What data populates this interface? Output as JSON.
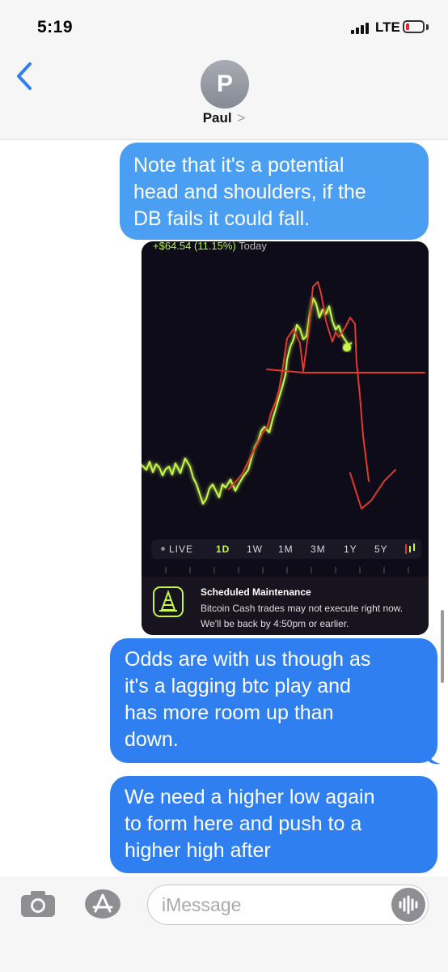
{
  "status_bar": {
    "time": "5:19",
    "network": "LTE",
    "icons": [
      "signal-icon",
      "battery-low-icon"
    ],
    "battery_color": "#e2292c"
  },
  "header": {
    "avatar_initial": "P",
    "contact_name": "Paul",
    "chevron": ">",
    "icons": [
      "back-chevron-icon"
    ]
  },
  "messages": [
    {
      "text": "Note that it's a potential head and shoulders, if the DB fails it could fall.",
      "lines": [
        "Note that it's a potential",
        "head and shoulders, if the",
        "DB fails it could fall."
      ],
      "color": "#4b9ff2"
    },
    {
      "text": "Odds are with us though as it's a lagging btc play and has more room up than down.",
      "lines": [
        "Odds are with us though as",
        "it's a lagging btc play and",
        "has more room up than",
        "down."
      ],
      "color": "#2f7ff0"
    },
    {
      "text": "We need a higher low again to form here and push to a higher high after",
      "lines": [
        "We need a higher low again",
        "to form here and push to a",
        "higher high after"
      ],
      "color": "#2f7ff0"
    }
  ],
  "attachment": {
    "gain_value": "+$64.54",
    "gain_percent": "(11.15%)",
    "gain_period": "Today",
    "line_color": "#c6f74c",
    "annotation_color": "#e23a2c",
    "tabs": [
      "LIVE",
      "1D",
      "1W",
      "1M",
      "3M",
      "1Y",
      "5Y"
    ],
    "active_tab": "1D",
    "maintenance": {
      "title": "Scheduled Maintenance",
      "line1": "Bitcoin Cash trades may not execute right now.",
      "line2": "We'll be back by 4:50pm or earlier."
    }
  },
  "composer": {
    "placeholder": "iMessage",
    "icons": [
      "camera-icon",
      "app-store-icon",
      "audio-waveform-icon"
    ]
  }
}
